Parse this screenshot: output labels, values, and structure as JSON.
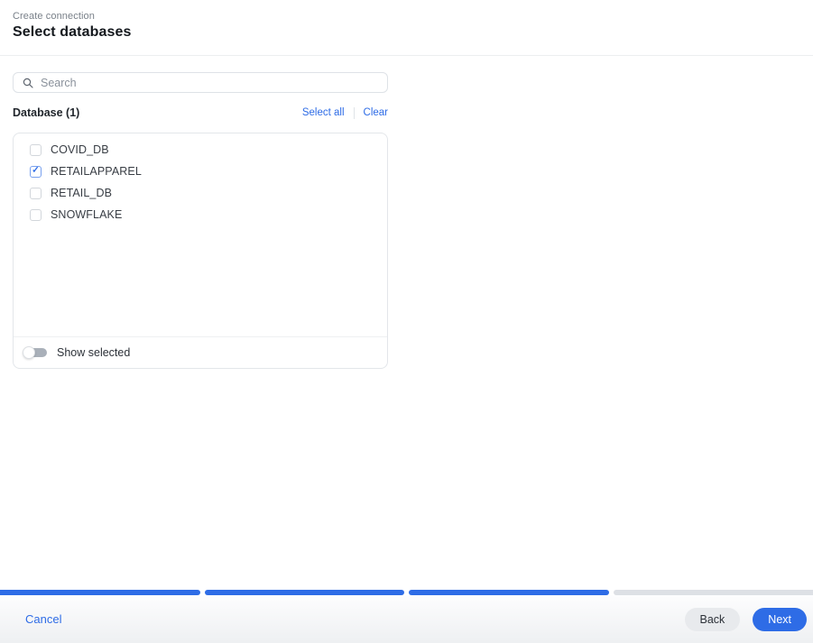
{
  "header": {
    "breadcrumb": "Create connection",
    "title": "Select databases"
  },
  "search": {
    "placeholder": "Search",
    "value": ""
  },
  "database_list": {
    "label": "Database (1)",
    "select_all_label": "Select all",
    "clear_label": "Clear",
    "items": [
      {
        "name": "COVID_DB",
        "checked": false
      },
      {
        "name": "RETAILAPPAREL",
        "checked": true
      },
      {
        "name": "RETAIL_DB",
        "checked": false
      },
      {
        "name": "SNOWFLAKE",
        "checked": false
      }
    ],
    "show_selected_label": "Show selected",
    "show_selected_on": false
  },
  "progress": {
    "segments_total": 4,
    "segments_complete": 3
  },
  "footer": {
    "cancel_label": "Cancel",
    "back_label": "Back",
    "next_label": "Next"
  },
  "colors": {
    "accent": "#2e6ce6",
    "progress_remaining": "#dde0e5",
    "checkbox_check": "#2e6ce6"
  },
  "icons": {
    "search": "magnifier",
    "checkbox_check_glyph": "✓"
  }
}
